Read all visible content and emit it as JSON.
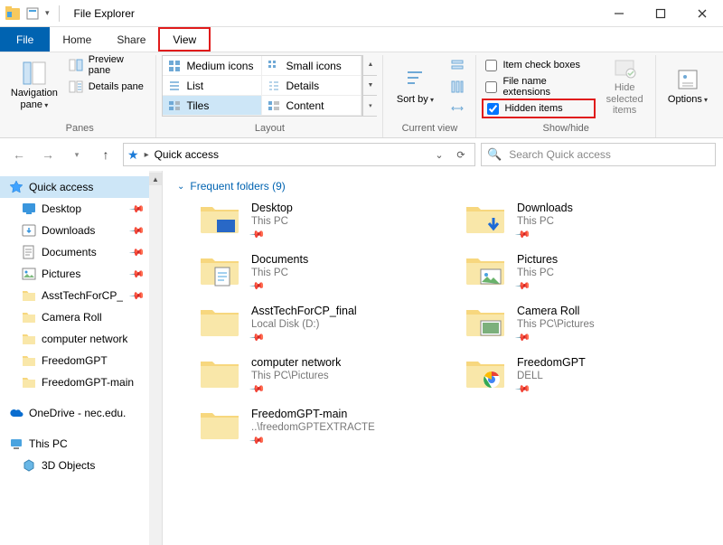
{
  "window": {
    "title": "File Explorer"
  },
  "tabs": {
    "file": "File",
    "home": "Home",
    "share": "Share",
    "view": "View"
  },
  "ribbon": {
    "panes": "Panes",
    "layout": "Layout",
    "current_view": "Current view",
    "show_hide": "Show/hide",
    "nav_pane": "Navigation pane",
    "preview_pane": "Preview pane",
    "details_pane": "Details pane",
    "medium_icons": "Medium icons",
    "small_icons": "Small icons",
    "list": "List",
    "details": "Details",
    "tiles": "Tiles",
    "content": "Content",
    "sort_by": "Sort by",
    "item_check_boxes": "Item check boxes",
    "file_name_extensions": "File name extensions",
    "hidden_items": "Hidden items",
    "hide_selected": "Hide selected items",
    "options": "Options"
  },
  "address": {
    "location": "Quick access"
  },
  "search": {
    "placeholder": "Search Quick access"
  },
  "sidebar": {
    "items": [
      {
        "label": "Quick access",
        "selected": true,
        "icon": "star"
      },
      {
        "label": "Desktop",
        "pin": true,
        "indent": true,
        "icon": "desktop"
      },
      {
        "label": "Downloads",
        "pin": true,
        "indent": true,
        "icon": "downloads"
      },
      {
        "label": "Documents",
        "pin": true,
        "indent": true,
        "icon": "documents"
      },
      {
        "label": "Pictures",
        "pin": true,
        "indent": true,
        "icon": "pictures"
      },
      {
        "label": "AsstTechForCP_",
        "pin": true,
        "indent": true,
        "icon": "folder"
      },
      {
        "label": "Camera Roll",
        "indent": true,
        "icon": "folder"
      },
      {
        "label": "computer network",
        "indent": true,
        "icon": "folder"
      },
      {
        "label": "FreedomGPT",
        "indent": true,
        "icon": "folder"
      },
      {
        "label": "FreedomGPT-main",
        "indent": true,
        "icon": "folder"
      },
      {
        "label": "",
        "sep": true
      },
      {
        "label": "OneDrive - nec.edu.",
        "icon": "onedrive"
      },
      {
        "label": "",
        "sep": true
      },
      {
        "label": "This PC",
        "icon": "thispc"
      },
      {
        "label": "3D Objects",
        "indent": true,
        "icon": "3d"
      }
    ]
  },
  "content": {
    "section_title": "Frequent folders (9)",
    "folders": [
      {
        "name": "Desktop",
        "sub": "This PC",
        "icon": "desktop-folder"
      },
      {
        "name": "Downloads",
        "sub": "This PC",
        "icon": "downloads-folder"
      },
      {
        "name": "Documents",
        "sub": "This PC",
        "icon": "documents-folder"
      },
      {
        "name": "Pictures",
        "sub": "This PC",
        "icon": "pictures-folder"
      },
      {
        "name": "AsstTechForCP_final",
        "sub": "Local Disk (D:)",
        "icon": "folder"
      },
      {
        "name": "Camera Roll",
        "sub": "This PC\\Pictures",
        "icon": "camera-folder"
      },
      {
        "name": "computer network",
        "sub": "This PC\\Pictures",
        "icon": "folder"
      },
      {
        "name": "FreedomGPT",
        "sub": "DELL",
        "icon": "chrome-folder"
      },
      {
        "name": "FreedomGPT-main",
        "sub": "..\\freedomGPTEXTRACTE",
        "icon": "folder"
      }
    ]
  }
}
